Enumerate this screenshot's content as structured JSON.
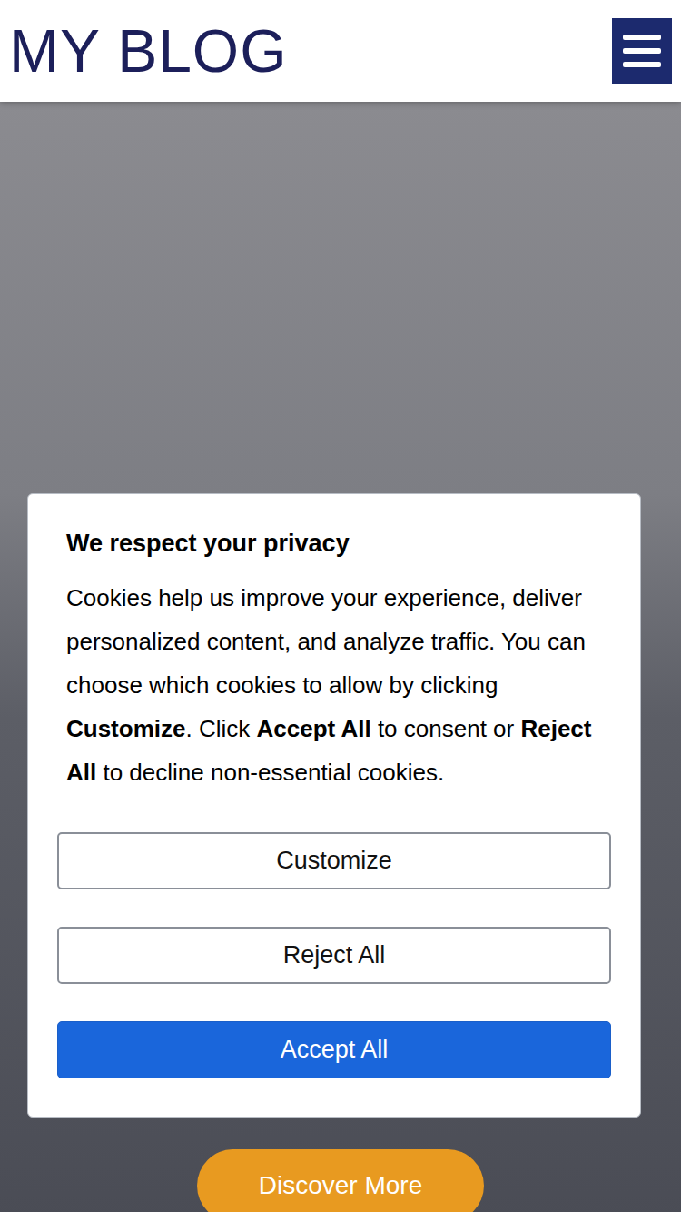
{
  "header": {
    "title": "MY BLOG",
    "menu_open": false
  },
  "hero": {
    "button": "Discover More"
  },
  "cookie_dialog": {
    "title": "We respect your privacy",
    "body": [
      {
        "text": "Cookies help us improve your experience, deliver personalized content, and analyze traffic. You can choose which cookies to allow by clicking ",
        "bold": false
      },
      {
        "text": "Customize",
        "bold": true
      },
      {
        "text": ". Click ",
        "bold": false
      },
      {
        "text": "Accept All",
        "bold": true
      },
      {
        "text": " to consent or ",
        "bold": false
      },
      {
        "text": "Reject All",
        "bold": true
      },
      {
        "text": " to decline non-essential cookies.",
        "bold": false
      }
    ],
    "buttons": [
      {
        "label": "Customize",
        "primary": false
      },
      {
        "label": "Reject All",
        "primary": false
      },
      {
        "label": "Accept All",
        "primary": true
      }
    ]
  }
}
